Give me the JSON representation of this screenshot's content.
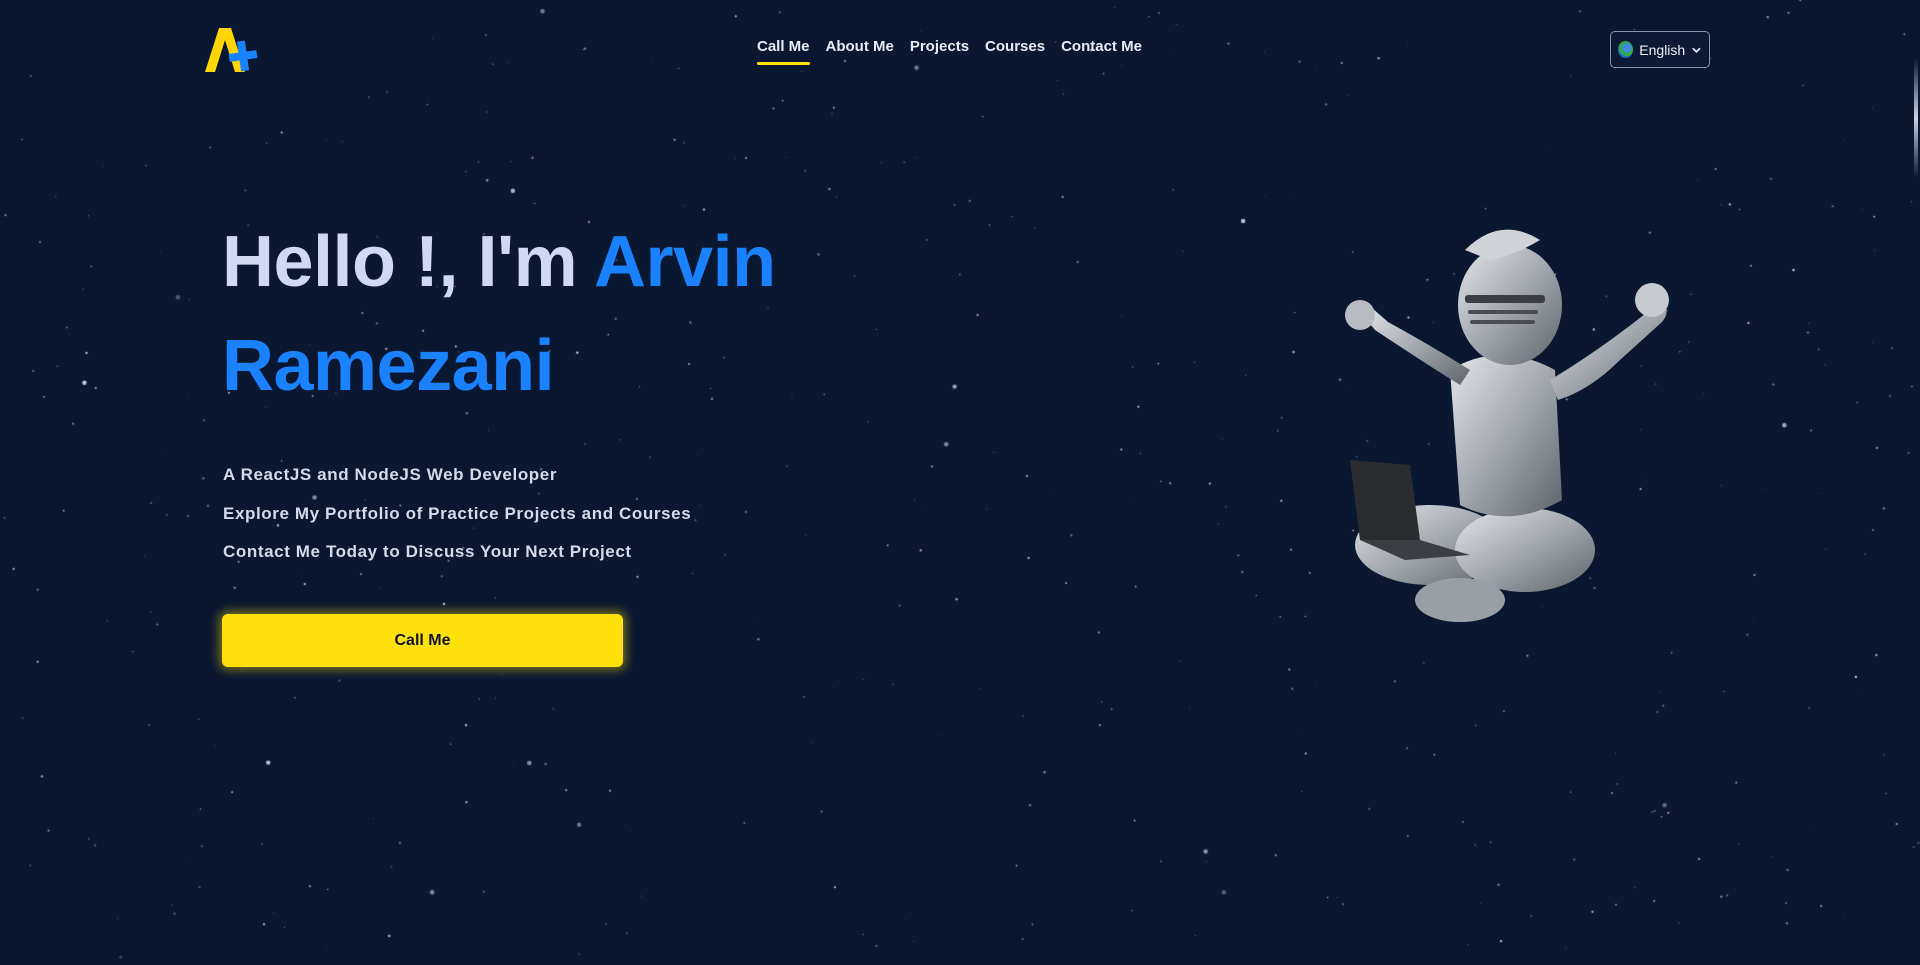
{
  "header": {
    "logo_text": "A+",
    "nav": [
      {
        "label": "Call Me",
        "active": true
      },
      {
        "label": "About Me",
        "active": false
      },
      {
        "label": "Projects",
        "active": false
      },
      {
        "label": "Courses",
        "active": false
      },
      {
        "label": "Contact Me",
        "active": false
      }
    ],
    "language": {
      "selected": "English",
      "icon": "globe-icon"
    }
  },
  "hero": {
    "greeting": "Hello !, I'm",
    "name_first": "Arvin",
    "name_last": "Ramezani",
    "lines": [
      "A ReactJS and NodeJS Web Developer",
      "Explore My Portfolio of Practice Projects and Courses",
      "Contact Me Today to Discuss Your Next Project"
    ],
    "cta_label": "Call Me",
    "illustration": "knight-with-laptop-illustration"
  },
  "colors": {
    "background": "#0a1730",
    "accent_blue": "#1a82ff",
    "accent_yellow": "#ffe008",
    "text_light": "#cfd9f2"
  }
}
